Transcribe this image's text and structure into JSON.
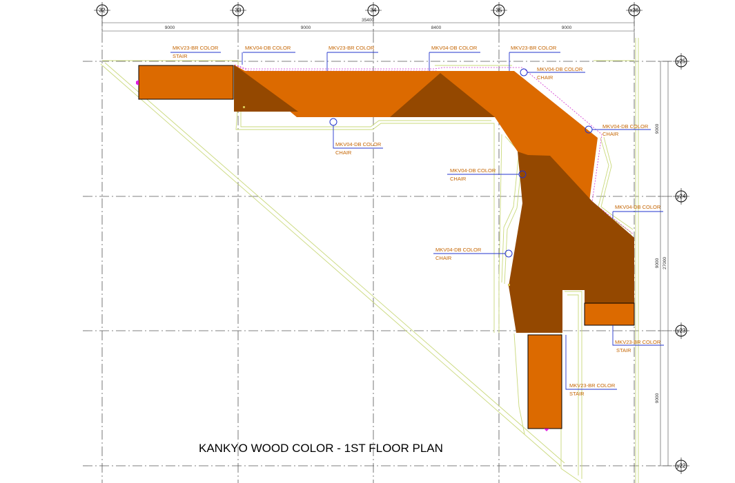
{
  "title": "KANKYO WOOD COLOR - 1ST FLOOR PLAN",
  "colors": {
    "mkv23_br": "#dc6a00",
    "mkv04_db": "#944800",
    "label_text": "#c46400",
    "leader": "#2233cc",
    "outline": "#c9d87a",
    "edge": "#d030d0"
  },
  "grid": {
    "columns": [
      "32",
      "33",
      "34",
      "35",
      "x36"
    ],
    "rows": [
      "y25",
      "y24",
      "y23",
      "y22"
    ]
  },
  "dimensions": {
    "overall": "35400",
    "spans": [
      "9000",
      "9000",
      "8400",
      "9000"
    ],
    "right_spans": [
      "9000",
      "9000",
      "9000"
    ],
    "right_total": "27000"
  },
  "labels": [
    {
      "code": "MKV23-BR COLOR",
      "sub": "STAIR"
    },
    {
      "code": "MKV04-DB COLOR",
      "sub": ""
    },
    {
      "code": "MKV23-BR COLOR",
      "sub": ""
    },
    {
      "code": "MKV04-DB COLOR",
      "sub": ""
    },
    {
      "code": "MKV23-BR COLOR",
      "sub": ""
    },
    {
      "code": "MKV04-DB COLOR",
      "sub": "CHAIR"
    },
    {
      "code": "MKV04-DB COLOR",
      "sub": "CHAIR"
    },
    {
      "code": "MKV04-DB COLOR",
      "sub": "CHAIR"
    },
    {
      "code": "MKV04-DB COLOR",
      "sub": "CHAIR"
    },
    {
      "code": "MKV04-DB COLOR",
      "sub": ""
    },
    {
      "code": "MKV04-DB COLOR",
      "sub": "CHAIR"
    },
    {
      "code": "MKV23-BR COLOR",
      "sub": "STAIR"
    },
    {
      "code": "MKV23-BR COLOR",
      "sub": "STAIR"
    }
  ]
}
